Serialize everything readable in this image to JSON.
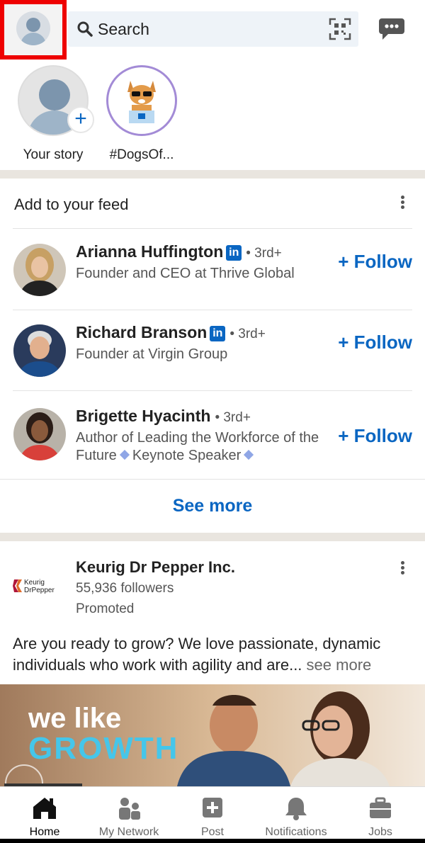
{
  "topbar": {
    "search_placeholder": "Search"
  },
  "stories": [
    {
      "label": "Your story"
    },
    {
      "label": "#DogsOf..."
    }
  ],
  "feed": {
    "title": "Add to your feed",
    "people": [
      {
        "name": "Arianna Huffington",
        "badge": "in",
        "degree": "• 3rd+",
        "subtitle": "Founder and CEO at Thrive Global",
        "follow": "+ Follow"
      },
      {
        "name": "Richard Branson",
        "badge": "in",
        "degree": "• 3rd+",
        "subtitle": "Founder at Virgin Group",
        "follow": "+ Follow"
      },
      {
        "name": "Brigette Hyacinth",
        "degree": "• 3rd+",
        "subtitle_a": "Author of Leading the Workforce of the Future",
        "subtitle_b": "Keynote Speaker",
        "follow": "+ Follow"
      }
    ],
    "see_more": "See more"
  },
  "post": {
    "company": "Keurig Dr Pepper Inc.",
    "followers": "55,936 followers",
    "promoted": "Promoted",
    "logo_text_1": "Keurig",
    "logo_text_2": "DrPepper",
    "text": "Are you ready to grow? We love passionate, dynamic individuals who work with agility and are...",
    "see_more": "see more",
    "banner_line1": "we like",
    "banner_line2": "GROWTH"
  },
  "bottom_nav": [
    {
      "label": "Home",
      "icon": "home-icon",
      "active": true
    },
    {
      "label": "My Network",
      "icon": "network-icon"
    },
    {
      "label": "Post",
      "icon": "post-icon"
    },
    {
      "label": "Notifications",
      "icon": "bell-icon"
    },
    {
      "label": "Jobs",
      "icon": "briefcase-icon"
    }
  ],
  "colors": {
    "accent": "#0a66c2",
    "highlight": "#ee0000",
    "separator": "#e9e5df"
  }
}
